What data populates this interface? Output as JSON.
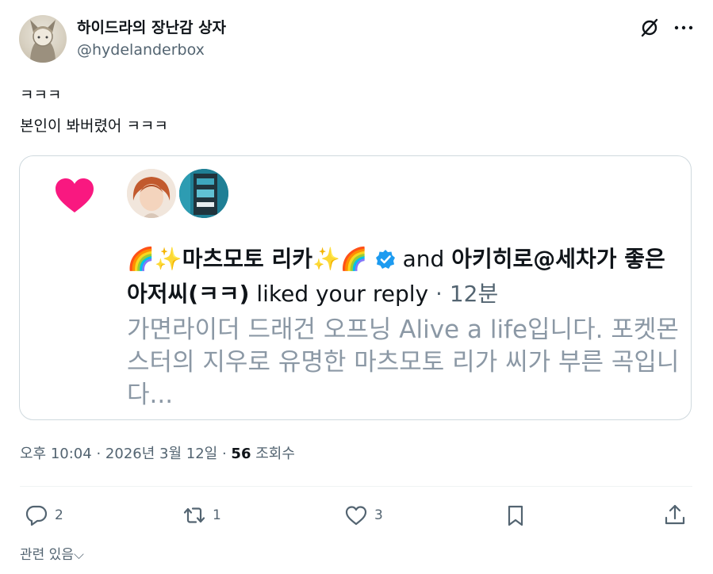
{
  "header": {
    "display_name": "하이드라의 장난감 상자",
    "handle": "@hydelanderbox",
    "grok_icon": "grok-icon",
    "more_icon": "more-icon"
  },
  "tweet": {
    "lines": [
      "ㅋㅋㅋ",
      "본인이 봐버렸어 ㅋㅋㅋ"
    ]
  },
  "card": {
    "user1_prefix_emoji": "🌈✨",
    "user1_name": "마츠모토 리카",
    "user1_suffix_emoji": "✨🌈",
    "and_text": "and",
    "user2_name": "아키히로@세차가 좋은 아저씨(ㅋㅋ)",
    "action_text": "liked your reply",
    "separator": "·",
    "time": "12분",
    "snippet": "가면라이더 드래건 오프닝 Alive a life입니다. 포켓몬스터의 지우로 유명한 마츠모토 리가 씨가 부른 곡입니다..."
  },
  "meta": {
    "time": "오후 10:04",
    "dot1": "·",
    "date": "2026년 3월 12일",
    "dot2": "·",
    "views_count": "56",
    "views_label": "조회수"
  },
  "actions": {
    "reply_count": "2",
    "retweet_count": "1",
    "like_count": "3",
    "bookmark_count": "",
    "share_count": ""
  },
  "related": {
    "label": "관련 있음",
    "chevron": "⌵"
  },
  "colors": {
    "text": "#0f1419",
    "secondary": "#536471",
    "snippet": "#8b98a5",
    "heart": "#f91880",
    "verified": "#1d9bf0",
    "border": "#cfd9de"
  }
}
